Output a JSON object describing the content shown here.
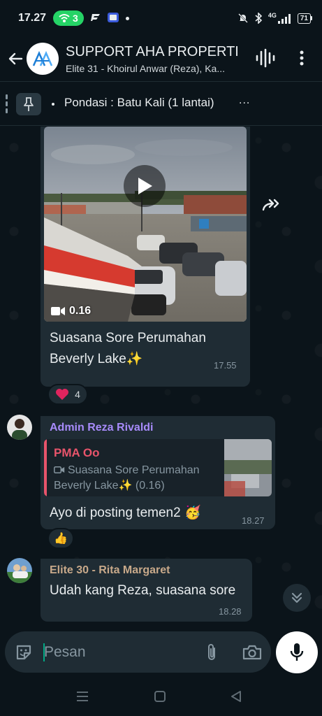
{
  "status_bar": {
    "time": "17.27",
    "call_count": "3",
    "network": "4G",
    "battery": "71"
  },
  "header": {
    "title": "SUPPORT AHA PROPERTI",
    "subtitle": "Elite 31 - Khoirul Anwar (Reza), Ka..."
  },
  "pinned": {
    "text": "Pondasi : Batu Kali (1 lantai)",
    "more": "..."
  },
  "messages": [
    {
      "type": "video",
      "duration": "0.16",
      "caption": "Suasana Sore Perumahan Beverly Lake✨",
      "time": "17.55",
      "reaction": {
        "emoji": "❤️",
        "count": "4"
      }
    },
    {
      "type": "text",
      "sender": "Admin Reza Rivaldi",
      "sender_color": "#a78bfa",
      "quoted": {
        "author": "PMA Oo",
        "author_color": "#e8546b",
        "text": "Suasana Sore Perumahan Beverly Lake✨ (0.16)"
      },
      "text": "Ayo di posting temen2 🥳",
      "time": "18.27",
      "reaction": {
        "emoji": "👍"
      }
    },
    {
      "type": "text",
      "sender": "Elite 30 - Rita Margaret",
      "sender_color": "#c8a98a",
      "text": "Udah kang Reza, suasana sore",
      "time": "18.28"
    }
  ],
  "composer": {
    "placeholder": "Pesan"
  },
  "colors": {
    "background": "#0b141a",
    "bubble": "#1f2c34",
    "accent": "#00a884"
  }
}
